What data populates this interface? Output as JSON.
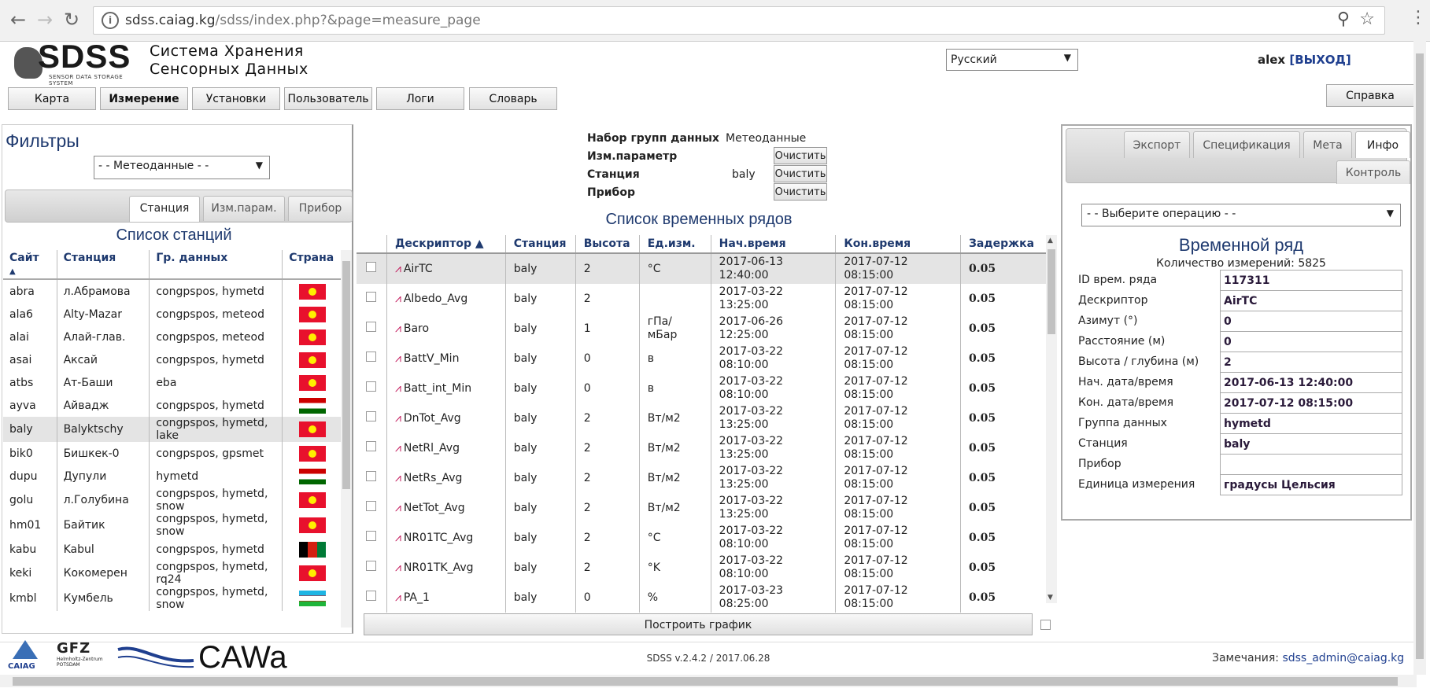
{
  "browser": {
    "url_host": "sdss.caiag.kg",
    "url_path": "/sdss/index.php?&page=measure_page"
  },
  "header": {
    "logo_text": "SDSS",
    "logo_subtitle": "SENSOR DATA STORAGE SYSTEM",
    "title_line1": "Система Хранения",
    "title_line2": "Сенсорных Данных",
    "language": "Русский",
    "user": "alex",
    "logout": "[ВЫХОД]"
  },
  "nav": {
    "items": [
      "Карта",
      "Измерение",
      "Установки",
      "Пользователь",
      "Логи",
      "Словарь"
    ],
    "help": "Справка"
  },
  "filters": {
    "title": "Фильтры",
    "group_select": "- - Метеоданные - -",
    "tabs": [
      "Станция",
      "Изм.парам.",
      "Прибор"
    ],
    "list_title": "Список станций",
    "columns": [
      "Сайт",
      "Станция",
      "Гр. данных",
      "Страна"
    ],
    "stations": [
      {
        "site": "abra",
        "name": "л.Абрамова",
        "groups": "congpspos, hymetd",
        "flag": "kg"
      },
      {
        "site": "ala6",
        "name": "Alty-Mazar",
        "groups": "congpspos, meteod",
        "flag": "kg"
      },
      {
        "site": "alai",
        "name": "Алай-глав.",
        "groups": "congpspos, meteod",
        "flag": "kg"
      },
      {
        "site": "asai",
        "name": "Аксай",
        "groups": "congpspos, hymetd",
        "flag": "kg"
      },
      {
        "site": "atbs",
        "name": "Ат-Баши",
        "groups": "eba",
        "flag": "kg"
      },
      {
        "site": "ayva",
        "name": "Айвадж",
        "groups": "congpspos, hymetd",
        "flag": "tj"
      },
      {
        "site": "baly",
        "name": "Balyktschy",
        "groups": "congpspos, hymetd, lake",
        "flag": "kg"
      },
      {
        "site": "bik0",
        "name": "Бишкек-0",
        "groups": "congpspos, gpsmet",
        "flag": "kg"
      },
      {
        "site": "dupu",
        "name": "Дупули",
        "groups": "hymetd",
        "flag": "tj"
      },
      {
        "site": "golu",
        "name": "л.Голубина",
        "groups": "congpspos, hymetd, snow",
        "flag": "kg"
      },
      {
        "site": "hm01",
        "name": "Байтик",
        "groups": "congpspos, hymetd, snow",
        "flag": "kg"
      },
      {
        "site": "kabu",
        "name": "Kabul",
        "groups": "congpspos, hymetd",
        "flag": "af"
      },
      {
        "site": "keki",
        "name": "Кокомерен",
        "groups": "congpspos, hymetd, rq24",
        "flag": "kg"
      },
      {
        "site": "kmbl",
        "name": "Кумбель",
        "groups": "congpspos, hymetd, snow",
        "flag": "uz"
      }
    ]
  },
  "measure": {
    "label_group": "Набор групп данных",
    "value_group": "Метеоданные",
    "label_param": "Изм.параметр",
    "label_station": "Станция",
    "value_station": "baly",
    "label_device": "Прибор",
    "clear": "Очистить",
    "list_title": "Список временных рядов",
    "columns": [
      "Дескриптор",
      "Станция",
      "Высота",
      "Ед.изм.",
      "Нач.время",
      "Кон.время",
      "Задержка"
    ],
    "rows": [
      {
        "desc": "AirTC",
        "station": "baly",
        "height": "2",
        "unit": "°C",
        "start1": "2017-06-13",
        "start2": "12:40:00",
        "end1": "2017-07-12",
        "end2": "08:15:00",
        "delay": "0.05"
      },
      {
        "desc": "Albedo_Avg",
        "station": "baly",
        "height": "2",
        "unit": "",
        "start1": "2017-03-22",
        "start2": "13:25:00",
        "end1": "2017-07-12",
        "end2": "08:15:00",
        "delay": "0.05"
      },
      {
        "desc": "Baro",
        "station": "baly",
        "height": "1",
        "unit": "гПа/\nмБар",
        "start1": "2017-06-26",
        "start2": "12:25:00",
        "end1": "2017-07-12",
        "end2": "08:15:00",
        "delay": "0.05"
      },
      {
        "desc": "BattV_Min",
        "station": "baly",
        "height": "0",
        "unit": "в",
        "start1": "2017-03-22",
        "start2": "08:10:00",
        "end1": "2017-07-12",
        "end2": "08:15:00",
        "delay": "0.05"
      },
      {
        "desc": "Batt_int_Min",
        "station": "baly",
        "height": "0",
        "unit": "в",
        "start1": "2017-03-22",
        "start2": "08:10:00",
        "end1": "2017-07-12",
        "end2": "08:15:00",
        "delay": "0.05"
      },
      {
        "desc": "DnTot_Avg",
        "station": "baly",
        "height": "2",
        "unit": "Вт/м2",
        "start1": "2017-03-22",
        "start2": "13:25:00",
        "end1": "2017-07-12",
        "end2": "08:15:00",
        "delay": "0.05"
      },
      {
        "desc": "NetRl_Avg",
        "station": "baly",
        "height": "2",
        "unit": "Вт/м2",
        "start1": "2017-03-22",
        "start2": "13:25:00",
        "end1": "2017-07-12",
        "end2": "08:15:00",
        "delay": "0.05"
      },
      {
        "desc": "NetRs_Avg",
        "station": "baly",
        "height": "2",
        "unit": "Вт/м2",
        "start1": "2017-03-22",
        "start2": "13:25:00",
        "end1": "2017-07-12",
        "end2": "08:15:00",
        "delay": "0.05"
      },
      {
        "desc": "NetTot_Avg",
        "station": "baly",
        "height": "2",
        "unit": "Вт/м2",
        "start1": "2017-03-22",
        "start2": "13:25:00",
        "end1": "2017-07-12",
        "end2": "08:15:00",
        "delay": "0.05"
      },
      {
        "desc": "NR01TC_Avg",
        "station": "baly",
        "height": "2",
        "unit": "°C",
        "start1": "2017-03-22",
        "start2": "08:10:00",
        "end1": "2017-07-12",
        "end2": "08:15:00",
        "delay": "0.05"
      },
      {
        "desc": "NR01TK_Avg",
        "station": "baly",
        "height": "2",
        "unit": "°K",
        "start1": "2017-03-22",
        "start2": "08:10:00",
        "end1": "2017-07-12",
        "end2": "08:15:00",
        "delay": "0.05"
      },
      {
        "desc": "PA_1",
        "station": "baly",
        "height": "0",
        "unit": "%",
        "start1": "2017-03-23",
        "start2": "08:25:00",
        "end1": "2017-07-12",
        "end2": "08:15:00",
        "delay": "0.05"
      }
    ],
    "plot_button": "Построить график"
  },
  "info": {
    "tabs": [
      "Экспорт",
      "Спецификация",
      "Мета",
      "Инфо"
    ],
    "tab_control": "Контроль",
    "operation_select": "- - Выберите операцию - -",
    "title": "Временной ряд",
    "count": "Количество измерений: 5825",
    "fields": [
      {
        "label": "ID врем. ряда",
        "value": "117311"
      },
      {
        "label": "Дескриптор",
        "value": "AirTC"
      },
      {
        "label": "Азимут (°)",
        "value": "0"
      },
      {
        "label": "Расстояние (м)",
        "value": "0"
      },
      {
        "label": "Высота / глубина (м)",
        "value": "2"
      },
      {
        "label": "Нач. дата/время",
        "value": "2017-06-13 12:40:00"
      },
      {
        "label": "Кон. дата/время",
        "value": "2017-07-12 08:15:00"
      },
      {
        "label": "Группа данных",
        "value": "hymetd"
      },
      {
        "label": "Станция",
        "value": "baly"
      },
      {
        "label": "Прибор",
        "value": ""
      },
      {
        "label": "Единица измерения",
        "value": "градусы Цельсия"
      }
    ]
  },
  "footer": {
    "logos": [
      "CAIAG",
      "GFZ",
      "Helmholtz-Zentrum POTSDAM",
      "CAWa"
    ],
    "version": "SDSS v.2.4.2 / 2017.06.28",
    "remarks_label": "Замечания:",
    "email": "sdss_admin@caiag.kg"
  }
}
